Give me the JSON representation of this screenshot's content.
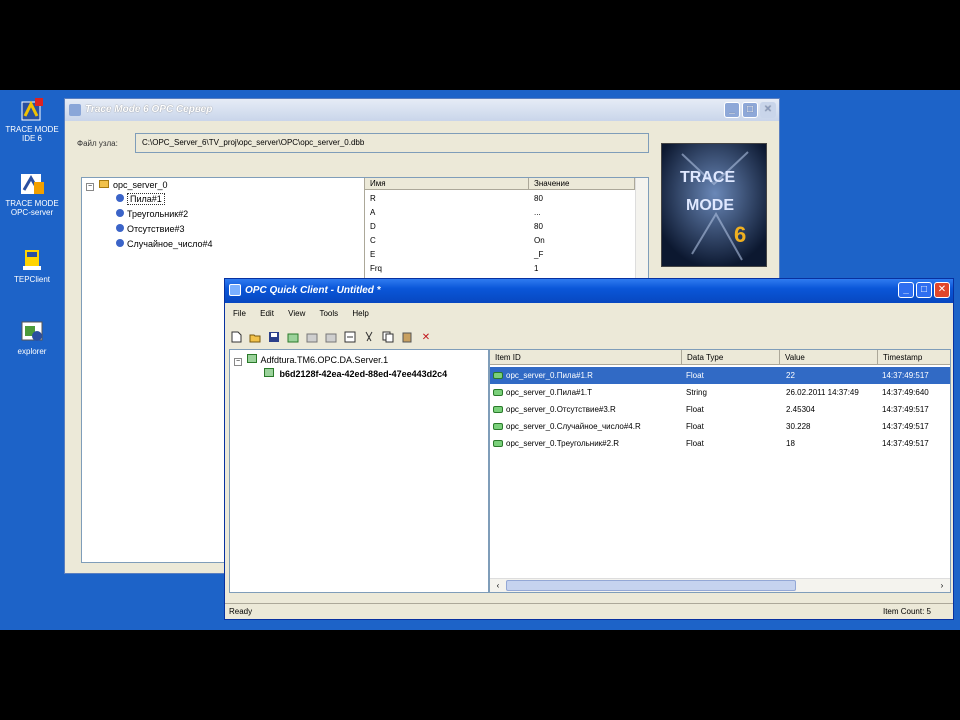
{
  "desktop_icons": [
    {
      "label": "TRACE MODE IDE 6",
      "icon": "trace-mode-ide-icon"
    },
    {
      "label": "TRACE MODE OPC-server",
      "icon": "opc-server-icon"
    },
    {
      "label": "TEPClient",
      "icon": "tepclient-icon"
    },
    {
      "label": "explorer",
      "icon": "explorer-icon"
    }
  ],
  "opc_server_window": {
    "title": "Trace Mode 6 OPC Сервер",
    "file_label": "Файл узла:",
    "file_path": "C:\\OPC_Server_6\\TV_proj\\opc_server\\OPC\\opc_server_0.dbb",
    "tree": {
      "root": "opc_server_0",
      "children": [
        "Пила#1",
        "Треугольник#2",
        "Отсутствие#3",
        "Случайное_число#4"
      ]
    },
    "grid": {
      "headers": [
        "Имя",
        "Значение"
      ],
      "rows": [
        [
          "R",
          "80"
        ],
        [
          "A",
          "..."
        ],
        [
          "D",
          "80"
        ],
        [
          "C",
          "On"
        ],
        [
          "E",
          "_F"
        ],
        [
          "Frq",
          "1"
        ]
      ]
    },
    "logo_text": "TRACE MODE 6"
  },
  "opc_client_window": {
    "title": "OPC Quick Client - Untitled *",
    "menu": [
      "File",
      "Edit",
      "View",
      "Tools",
      "Help"
    ],
    "tree": {
      "server": "Adfdtura.TM6.OPC.DA.Server.1",
      "group": "b6d2128f-42ea-42ed-88ed-47ee443d2c4"
    },
    "columns": [
      "Item ID",
      "Data Type",
      "Value",
      "Timestamp"
    ],
    "items": [
      {
        "id": "opc_server_0.Пила#1.R",
        "type": "Float",
        "value": "22",
        "time": "14:37:49:517",
        "selected": true
      },
      {
        "id": "opc_server_0.Пила#1.T",
        "type": "String",
        "value": "26.02.2011 14:37:49",
        "time": "14:37:49:640",
        "selected": false
      },
      {
        "id": "opc_server_0.Отсутствие#3.R",
        "type": "Float",
        "value": "2.45304",
        "time": "14:37:49:517",
        "selected": false
      },
      {
        "id": "opc_server_0.Случайное_число#4.R",
        "type": "Float",
        "value": "30.228",
        "time": "14:37:49:517",
        "selected": false
      },
      {
        "id": "opc_server_0.Треугольник#2.R",
        "type": "Float",
        "value": "18",
        "time": "14:37:49:517",
        "selected": false
      }
    ],
    "status_left": "Ready",
    "status_right": "Item Count: 5"
  },
  "colors": {
    "desktop": "#1d63c8",
    "xp_title": "#0a56d8",
    "selection": "#316ac5"
  }
}
